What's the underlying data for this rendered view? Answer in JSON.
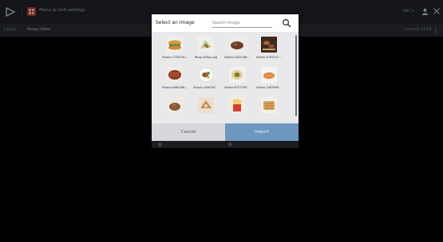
{
  "titlebar": {
    "title": "Menu & Unit settings",
    "language": "ENG",
    "logo_icon": "play-logo-icon",
    "app_icon": "menu-grid-icon",
    "user_icon": "user-icon",
    "close_icon": "close-icon"
  },
  "breadcrumb": {
    "library": "Library",
    "current": "Recipe Editor",
    "user_info": "cssend3 17:57",
    "chevron": "▾"
  },
  "modal": {
    "title": "Select an Image",
    "search": {
      "placeholder": "Search Image",
      "value": "",
      "icon": "search-icon"
    },
    "images": [
      {
        "caption": "iStock-1733126...",
        "kind": "sandwich"
      },
      {
        "caption": "Wrap 400px.jpg",
        "kind": "wrap"
      },
      {
        "caption": "iStock-5402338...",
        "kind": "steak"
      },
      {
        "caption": "iStock-4761517...",
        "kind": "grill"
      },
      {
        "caption": "iStock-4984288...",
        "kind": "ribs"
      },
      {
        "caption": "iStock-1056787...",
        "kind": "plate"
      },
      {
        "caption": "iStock-6757763...",
        "kind": "burrito"
      },
      {
        "caption": "iStock-1387609...",
        "kind": "salmon"
      },
      {
        "caption": "",
        "kind": "meatball"
      },
      {
        "caption": "",
        "kind": "dessert"
      },
      {
        "caption": "",
        "kind": "fries"
      },
      {
        "caption": "",
        "kind": "toast"
      }
    ],
    "cancel_label": "Cancel",
    "import_label": "Import"
  },
  "colors": {
    "titlebar_bg": "#1f232b",
    "modal_bg": "#e9e9ec",
    "import_bg": "#6d97bf",
    "cancel_bg": "#d6d8dc"
  }
}
